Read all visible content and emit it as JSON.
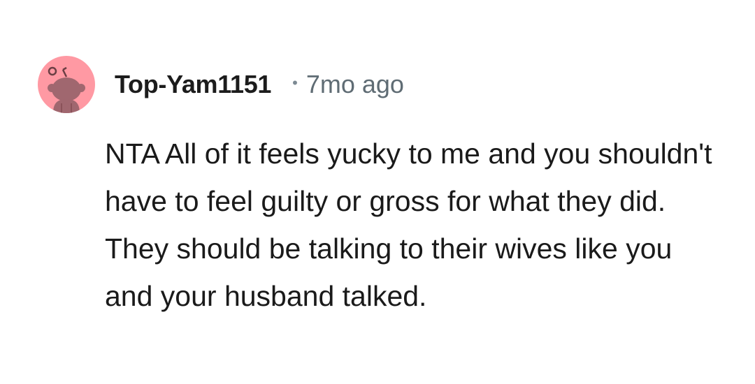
{
  "comment": {
    "author": "Top-Yam1151",
    "separator": "•",
    "timestamp": "7mo ago",
    "body": "NTA All of it feels yucky to me and you shouldn't have to feel guilty or gross for what they did. They should be talking to their wives like you and your husband talked.",
    "avatar_icon": "snoo-avatar-icon",
    "avatar_bg_color": "#ff99a3"
  }
}
